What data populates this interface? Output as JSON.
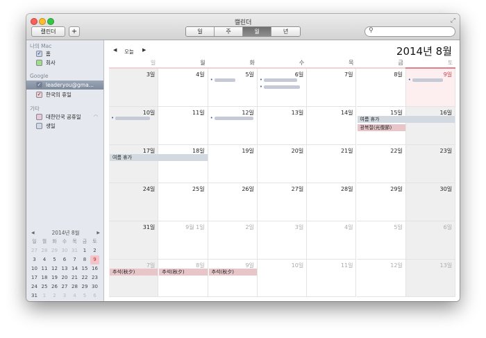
{
  "window": {
    "title": "캘린더"
  },
  "toolbar": {
    "calendars_label": "캘린더",
    "add_label": "+",
    "views": [
      "일",
      "주",
      "월",
      "년"
    ],
    "active_view": "월"
  },
  "search": {
    "placeholder": ""
  },
  "sidebar": {
    "sections": [
      {
        "header": "나의 Mac",
        "items": [
          {
            "label": "홈",
            "color": "#c6d4f2",
            "checked": true
          },
          {
            "label": "회사",
            "color": "#9fdc8d",
            "checked": false
          }
        ]
      },
      {
        "header": "Google",
        "items": [
          {
            "label": "leaderyou@gma...",
            "color": "#6b7d9b",
            "checked": true,
            "selected": true
          },
          {
            "label": "한국의 휴일",
            "color": "#f0cdd2",
            "checked": true
          }
        ]
      },
      {
        "header": "기타",
        "items": [
          {
            "label": "대한민국 공휴일",
            "color": "#e6c7db",
            "checked": false
          },
          {
            "label": "생일",
            "color": "#cdd8ea",
            "checked": false
          }
        ]
      }
    ]
  },
  "mini_calendar": {
    "title": "2014년 8월",
    "weekdays": [
      "일",
      "월",
      "화",
      "수",
      "목",
      "금",
      "토"
    ],
    "days": [
      27,
      28,
      29,
      30,
      31,
      1,
      2,
      3,
      4,
      5,
      6,
      7,
      8,
      9,
      10,
      11,
      12,
      13,
      14,
      15,
      16,
      17,
      18,
      19,
      20,
      21,
      22,
      23,
      24,
      25,
      26,
      27,
      28,
      29,
      30,
      31,
      1,
      2,
      3,
      4,
      5,
      6
    ],
    "today": 9
  },
  "nav": {
    "today_label": "오늘",
    "month_title": "2014년 8월"
  },
  "columns": [
    "일",
    "월",
    "화",
    "수",
    "목",
    "금",
    "토"
  ],
  "weeks": [
    [
      "3일",
      "4일",
      "5일",
      "6일",
      "7일",
      "8일",
      "9일"
    ],
    [
      "10일",
      "11일",
      "12일",
      "13일",
      "14일",
      "15일",
      "16일"
    ],
    [
      "17일",
      "18일",
      "19일",
      "20일",
      "21일",
      "22일",
      "23일"
    ],
    [
      "24일",
      "25일",
      "26일",
      "27일",
      "28일",
      "29일",
      "30일"
    ],
    [
      "31일",
      "9월 1일",
      "2일",
      "3일",
      "4일",
      "5일",
      "6일"
    ],
    [
      "7일",
      "8일",
      "9일",
      "10일",
      "11일",
      "12일",
      "13일"
    ]
  ],
  "events": {
    "summer1": "여름 휴가",
    "summer2": "여름 휴가",
    "liberation": "광복절(光復節)",
    "chuseok": [
      "추석(秋夕)",
      "추석(秋夕)",
      "추석(秋夕)"
    ]
  },
  "colors": {
    "today": "#d43d4a",
    "accent": "#3b5aa4"
  }
}
